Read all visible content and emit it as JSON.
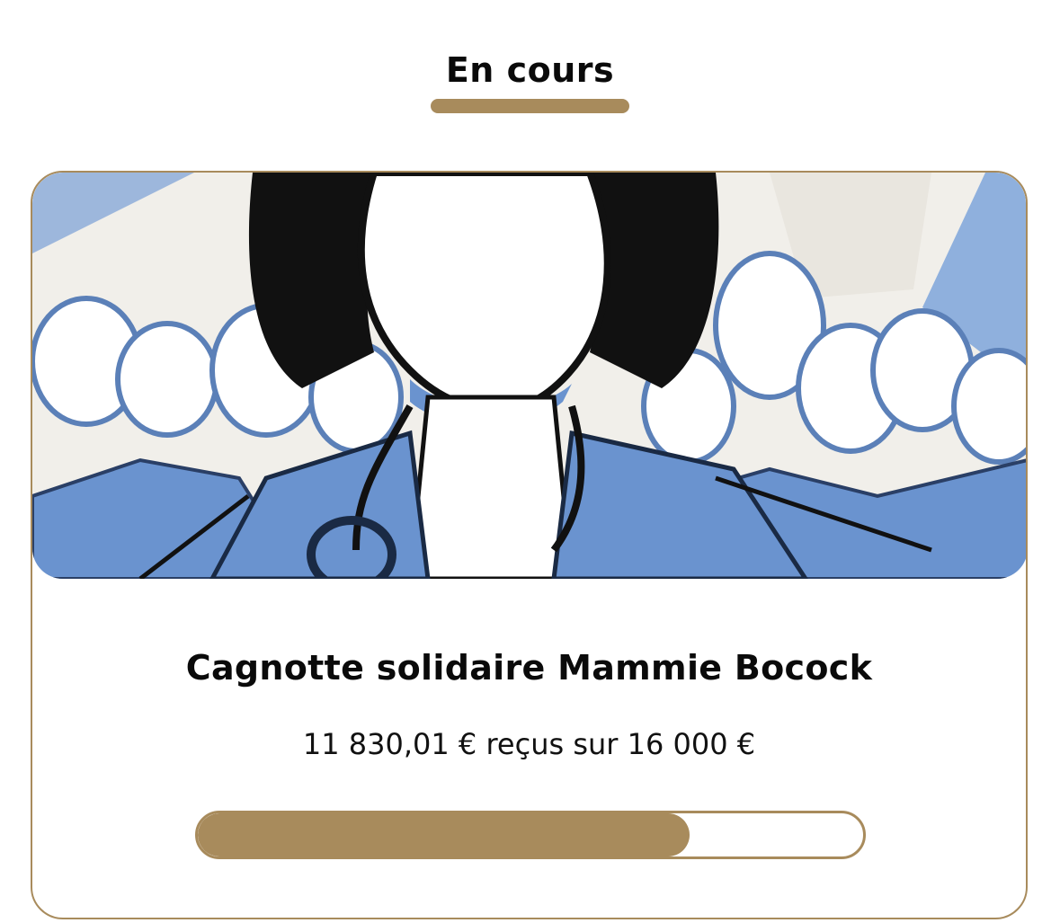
{
  "section": {
    "tab_title": "En cours",
    "accent_color": "#a88b5c"
  },
  "campaign": {
    "image_icon": "illustration-crowd-woman",
    "title": "Cagnotte solidaire Mammie Bocock",
    "amount_text": "11 830,01 € reçus sur 16 000 €",
    "progress": {
      "raised": 11830.01,
      "goal": 16000,
      "fraction": 0.739
    }
  }
}
